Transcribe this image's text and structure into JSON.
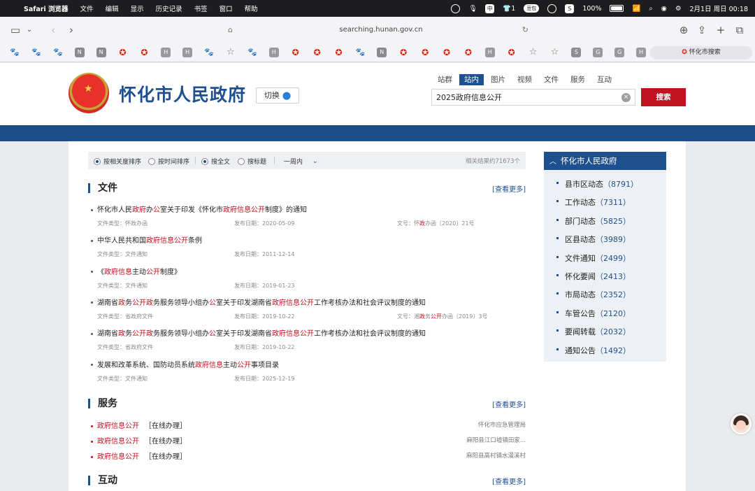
{
  "menubar": {
    "app": "Safari 浏览器",
    "items": [
      "文件",
      "编辑",
      "显示",
      "历史记录",
      "书签",
      "窗口",
      "帮助"
    ],
    "ime_label": "中",
    "badge": "1",
    "pill_label": "豆包",
    "battery": "100%",
    "datetime": "2月1日 周日 00:18"
  },
  "safari": {
    "url": "searching.hunan.gov.cn",
    "fav_search_label": "怀化市搜索"
  },
  "header": {
    "site_name": "怀化市人民政府",
    "switch_label": "切换",
    "tabs": [
      "站群",
      "站内",
      "图片",
      "视频",
      "文件",
      "服务",
      "互动"
    ],
    "active_tab": "站内",
    "search_value": "2025政府信息公开",
    "search_button": "搜索"
  },
  "filter": {
    "opts": [
      "按相关度排序",
      "按时间排序",
      "搜全文",
      "搜标题"
    ],
    "time_range": "一周内",
    "result_count": "相关结果约71673个"
  },
  "sections": {
    "files_title": "文件",
    "services_title": "服务",
    "interact_title": "互动",
    "more_label": "[查看更多]"
  },
  "files": [
    {
      "title_parts": [
        [
          "怀化市人民",
          0
        ],
        [
          "政府",
          1
        ],
        [
          "办",
          0
        ],
        [
          "公",
          1
        ],
        [
          "室关于印发《怀化市",
          0
        ],
        [
          "政府信息公开",
          1
        ],
        [
          "制度》的通知",
          0
        ]
      ],
      "type": "文件类型：怀政办函",
      "date": "发布日期：2020-05-09",
      "doc_parts": [
        [
          "文号：怀",
          0
        ],
        [
          "政",
          1
        ],
        [
          "办函〔2020〕21号",
          0
        ]
      ]
    },
    {
      "title_parts": [
        [
          "中华人民共和国",
          0
        ],
        [
          "政府信息公开",
          1
        ],
        [
          "条例",
          0
        ]
      ],
      "type": "文件类型：文件通知",
      "date": "发布日期：2011-12-14",
      "doc_parts": []
    },
    {
      "title_parts": [
        [
          "《",
          0
        ],
        [
          "政府信息",
          1
        ],
        [
          "主动",
          0
        ],
        [
          "公开",
          1
        ],
        [
          "制度》",
          0
        ]
      ],
      "type": "文件类型：文件通知",
      "date": "发布日期：2019-01-23",
      "doc_parts": []
    },
    {
      "title_parts": [
        [
          "湖南省",
          0
        ],
        [
          "政",
          1
        ],
        [
          "务",
          0
        ],
        [
          "公开政",
          1
        ],
        [
          "务服务领导小组办",
          0
        ],
        [
          "公",
          1
        ],
        [
          "室关于印发湖南省",
          0
        ],
        [
          "政府信息公开",
          1
        ],
        [
          "工作考核办法和社会评议制度的通知",
          0
        ]
      ],
      "type": "文件类型：省政府文件",
      "date": "发布日期：2019-10-22",
      "doc_parts": [
        [
          "文号：湘",
          0
        ],
        [
          "政",
          1
        ],
        [
          "务",
          0
        ],
        [
          "公开",
          1
        ],
        [
          "办函〔2019〕3号",
          0
        ]
      ]
    },
    {
      "title_parts": [
        [
          "湖南省",
          0
        ],
        [
          "政",
          1
        ],
        [
          "务",
          0
        ],
        [
          "公开政",
          1
        ],
        [
          "务服务领导小组办",
          0
        ],
        [
          "公",
          1
        ],
        [
          "室关于印发湖南省",
          0
        ],
        [
          "政府信息公开",
          1
        ],
        [
          "工作考核办法和社会评议制度的通知",
          0
        ]
      ],
      "type": "文件类型：省政府文件",
      "date": "发布日期：2019-10-22",
      "doc_parts": []
    },
    {
      "title_parts": [
        [
          "发展和改革系统、国防动员系统",
          0
        ],
        [
          "政府信息",
          1
        ],
        [
          "主动",
          0
        ],
        [
          "公开",
          1
        ],
        [
          "事项目录",
          0
        ]
      ],
      "type": "文件类型：文件通知",
      "date": "发布日期：2025-12-19",
      "doc_parts": []
    }
  ],
  "services": [
    {
      "name": "政府信息公开",
      "tag": "［在线办理］",
      "source": "怀化市应急管理局"
    },
    {
      "name": "政府信息公开",
      "tag": "［在线办理］",
      "source": "麻阳县江口墟镇田家..."
    },
    {
      "name": "政府信息公开",
      "tag": "［在线办理］",
      "source": "麻阳县高村镇水漫溪村"
    }
  ],
  "sidebar": {
    "title": "怀化市人民政府",
    "items": [
      {
        "label": "县市区动态",
        "count": "（8791）"
      },
      {
        "label": "工作动态",
        "count": "（7311）"
      },
      {
        "label": "部门动态",
        "count": "（5825）"
      },
      {
        "label": "区县动态",
        "count": "（3989）"
      },
      {
        "label": "文件通知",
        "count": "（2499）"
      },
      {
        "label": "怀化要闻",
        "count": "（2413）"
      },
      {
        "label": "市局动态",
        "count": "（2352）"
      },
      {
        "label": "车管公告",
        "count": "（2120）"
      },
      {
        "label": "要闻转载",
        "count": "（2032）"
      },
      {
        "label": "通知公告",
        "count": "（1492）"
      }
    ]
  },
  "favorites": [
    "paw",
    "paw",
    "paw",
    "N",
    "N",
    "emb",
    "emb",
    "H",
    "H",
    "paw",
    "star",
    "paw",
    "H",
    "emb",
    "emb",
    "emb",
    "paw",
    "N",
    "emb",
    "emb",
    "emb",
    "emb",
    "H",
    "emb",
    "star",
    "star",
    "S",
    "G",
    "G",
    "H"
  ],
  "colors": {
    "brand_blue": "#1e4f8f",
    "highlight_red": "#c1121f"
  }
}
